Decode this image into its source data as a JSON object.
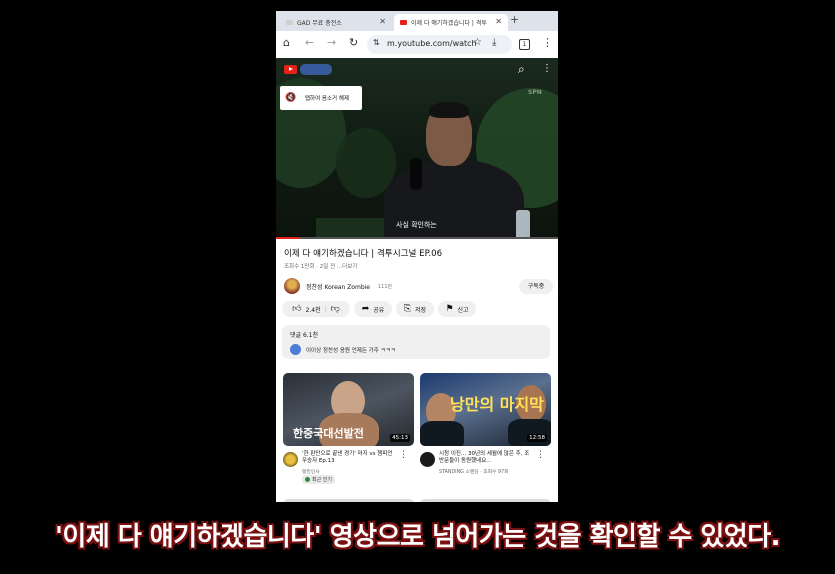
{
  "browser": {
    "tabs": [
      {
        "label": "GAD 무료 충전소",
        "favicon_color": "#e5e5e5"
      },
      {
        "label": "이제 다 얘기하겠습니다 | 격투",
        "favicon_color": "#e62117"
      }
    ],
    "url": "m.youtube.com/watch",
    "tab_count": "1"
  },
  "video": {
    "unmute_label": "탭하여 음소거 해제",
    "caption_text": "사실 확인하는",
    "brand_watermark": "SPN",
    "progress_fraction": 0.08
  },
  "meta": {
    "title": "이제 다 얘기하겠습니다 | 격투시그널 EP.06",
    "stats": "조회수 1만회 · 2일 전  ...더보기",
    "channel_name": "정찬성 Korean Zombie",
    "subscribers": "111만",
    "subscribe_label": "구독중"
  },
  "actions": {
    "like_count": "2.4천",
    "share_label": "공유",
    "save_label": "저장",
    "report_label": "신고"
  },
  "comments": {
    "count_label": "댓글 6.1천",
    "top_comment": "이이상 정찬성 응원 언제든 가주 ㅋㅋㅋ"
  },
  "recommendations": [
    {
      "thumb_text": "한중국대선발전",
      "duration": "45:13",
      "title": "'한 판만으로 끝낸 경기' 마지 vs 챔피언 우승자 Ep.13",
      "channel": "랭킹인사",
      "badge": "최근 인기"
    },
    {
      "thumb_text": "낭만의 마지막",
      "duration": "12:58",
      "title": "시청 이진... 30년의 세월에 많은 주, 조반문들이 동원했네요...",
      "channel": "STANDING 스탠딩 · 조회수 97회",
      "badge": ""
    }
  ],
  "subtitle": "'이제 다 얘기하겠습니다' 영상으로 넘어가는 것을 확인할 수 있었다."
}
